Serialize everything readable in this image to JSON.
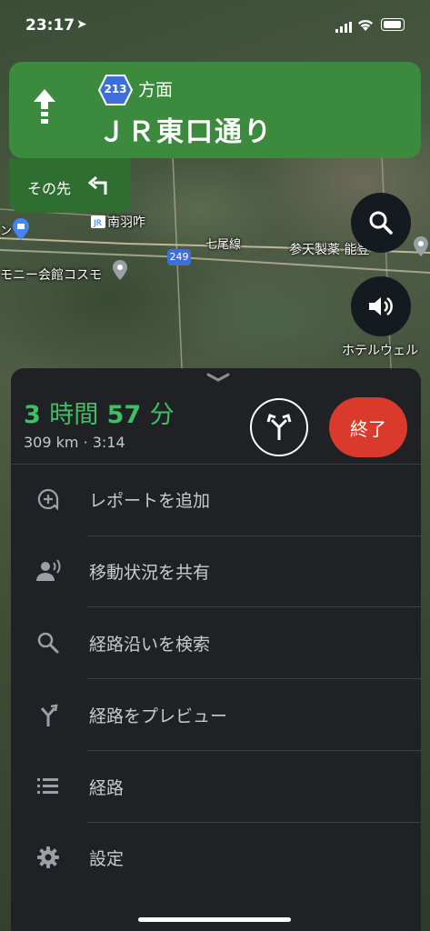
{
  "status_bar": {
    "time": "23:17",
    "location_glyph": "➤"
  },
  "nav": {
    "route_number": "213",
    "direction_suffix": "方面",
    "street": "ＪＲ東口通り",
    "then_label": "その先",
    "colors": {
      "primary": "#3b8a3e",
      "secondary": "#2f6e31"
    }
  },
  "map_labels": {
    "station": "南羽咋",
    "line": "七尾線",
    "route_shield": "249",
    "business": "参天製薬 能登",
    "hall": "モニー会館コスモ",
    "hotel": "ホテルウェル",
    "left_edge": "ン"
  },
  "trip": {
    "eta_hours": "3",
    "hours_unit": "時間",
    "eta_minutes": "57",
    "minutes_unit": "分",
    "details": "309 km · 3:14",
    "end_label": "終了",
    "eta_color": "#3fbf63",
    "end_color": "#d93a2b"
  },
  "menu": [
    {
      "label": "レポートを追加",
      "icon": "add-report-icon"
    },
    {
      "label": "移動状況を共有",
      "icon": "share-location-icon"
    },
    {
      "label": "経路沿いを検索",
      "icon": "search-icon"
    },
    {
      "label": "経路をプレビュー",
      "icon": "route-preview-icon"
    },
    {
      "label": "経路",
      "icon": "list-icon"
    },
    {
      "label": "設定",
      "icon": "gear-icon"
    }
  ]
}
